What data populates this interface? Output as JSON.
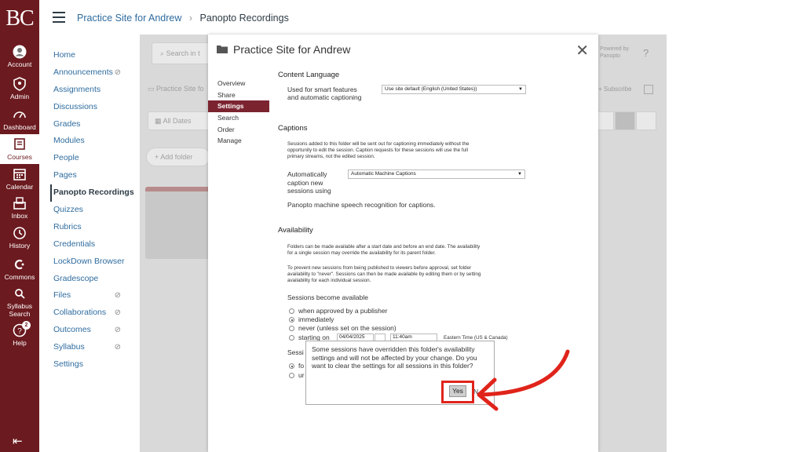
{
  "global_nav": {
    "logo": "BC",
    "items": [
      {
        "label": "Account",
        "icon": "account-icon"
      },
      {
        "label": "Admin",
        "icon": "admin-icon"
      },
      {
        "label": "Dashboard",
        "icon": "dashboard-icon"
      },
      {
        "label": "Courses",
        "icon": "courses-icon"
      },
      {
        "label": "Calendar",
        "icon": "calendar-icon"
      },
      {
        "label": "Inbox",
        "icon": "inbox-icon"
      },
      {
        "label": "History",
        "icon": "history-icon"
      },
      {
        "label": "Commons",
        "icon": "commons-icon"
      },
      {
        "label": "Syllabus Search",
        "line1": "Syllabus",
        "line2": "Search",
        "icon": "syllabus-search-icon"
      },
      {
        "label": "Help",
        "icon": "help-icon",
        "badge": "2"
      }
    ],
    "collapse_glyph": "⇤"
  },
  "header": {
    "breadcrumb": [
      "Practice Site for Andrew",
      "Panopto Recordings"
    ],
    "separator": "›"
  },
  "course_nav": {
    "items": [
      {
        "label": "Home"
      },
      {
        "label": "Announcements",
        "hidden": true
      },
      {
        "label": "Assignments"
      },
      {
        "label": "Discussions"
      },
      {
        "label": "Grades"
      },
      {
        "label": "Modules"
      },
      {
        "label": "People"
      },
      {
        "label": "Pages"
      },
      {
        "label": "Panopto Recordings",
        "active": true
      },
      {
        "label": "Quizzes"
      },
      {
        "label": "Rubrics"
      },
      {
        "label": "Credentials"
      },
      {
        "label": "LockDown Browser"
      },
      {
        "label": "Gradescope"
      },
      {
        "label": "Files",
        "hidden": true
      },
      {
        "label": "Collaborations",
        "hidden": true
      },
      {
        "label": "Outcomes",
        "hidden": true
      },
      {
        "label": "Syllabus",
        "hidden": true
      },
      {
        "label": "Settings"
      }
    ],
    "hidden_glyph": "⊘"
  },
  "background": {
    "search_placeholder": "Search in t",
    "folder_crumb": "Practice Site fo",
    "all_dates": "All Dates",
    "add_folder": "Add folder",
    "powered_by_line1": "Powered by",
    "powered_by_line2": "Panopto",
    "help": "?",
    "subscribe": "Subscribe"
  },
  "modal": {
    "title": "Practice Site for Andrew",
    "close": "✕",
    "nav": [
      "Overview",
      "Share",
      "Settings",
      "Search",
      "Order",
      "Manage"
    ],
    "active_nav": "Settings",
    "content_language": {
      "title": "Content Language",
      "label_line1": "Used for smart features",
      "label_line2": "and automatic captioning",
      "value": "Use site default (English (United States))"
    },
    "captions": {
      "title": "Captions",
      "desc_line1": "Sessions added to this folder will be sent out for captioning immediately without the",
      "desc_line2": "opportunity to edit the session. Caption requests for these sessions will use the full",
      "desc_line3": "primary streams, not the edited session.",
      "label_line1": "Automatically",
      "label_line2": "caption new",
      "label_line3": "sessions using",
      "value": "Automatic Machine Captions",
      "note": "Panopto machine speech recognition for captions."
    },
    "availability": {
      "title": "Availability",
      "desc1_line1": "Folders can be made available after a start date and before an end date. The availability",
      "desc1_line2": "for a single session may override the availability for its parent folder.",
      "desc2_line1": "To prevent new sessions from being published to viewers before approval, set folder",
      "desc2_line2": "availability to \"never\". Sessions can then be made available by editing them or by setting",
      "desc2_line3": "availability for each individual session.",
      "become_label": "Sessions become available",
      "options": [
        "when approved by a publisher",
        "immediately",
        "never (unless set on the session)",
        "starting on"
      ],
      "selected": "immediately",
      "date": "04/04/2025",
      "time": "11:40am",
      "timezone": "Eastern Time (US & Canada)",
      "sessions_partial": "Sessi",
      "partial_opt1": "fo",
      "partial_opt2": "ur"
    }
  },
  "confirm": {
    "message": "Some sessions have overridden this folder's availability settings and will not be affected by your change. Do you want to clear the settings for all sessions in this folder?",
    "yes": "Yes",
    "no_partial": "N"
  },
  "colors": {
    "nav_bg": "#6b1a1f",
    "active_tab": "#7b2430",
    "link": "#2f6c9f",
    "highlight": "#e0241b"
  }
}
